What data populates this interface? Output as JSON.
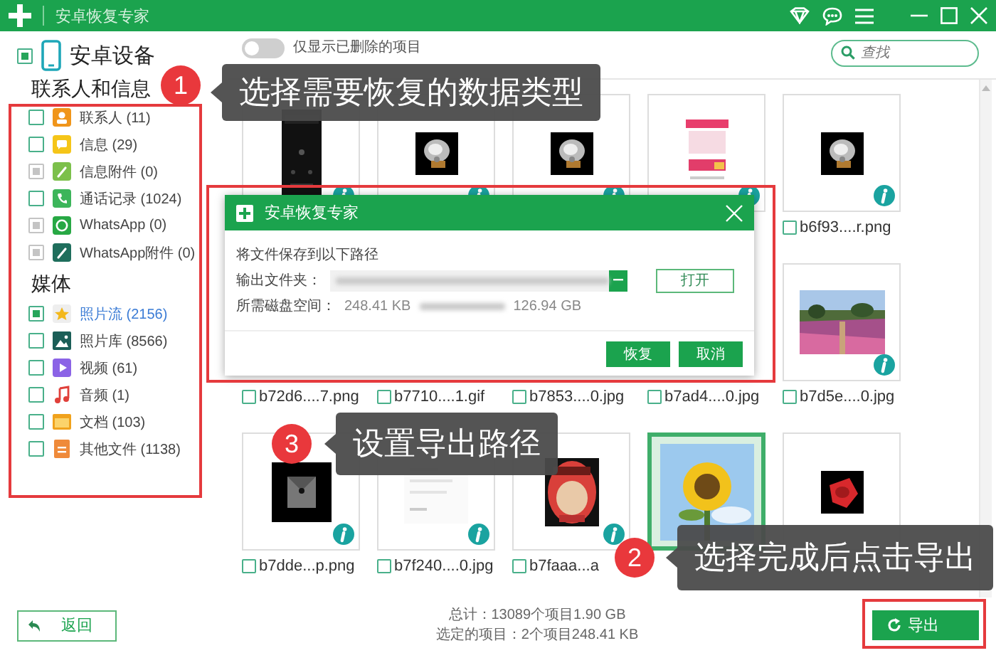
{
  "window": {
    "title": "安卓恢复专家"
  },
  "sidebar": {
    "device": {
      "label": "安卓设备",
      "checked": true
    },
    "groups": [
      {
        "heading": "联系人和信息",
        "items": [
          {
            "label": "联系人 (11)",
            "checked": false,
            "disabled": false,
            "selected": false
          },
          {
            "label": "信息 (29)",
            "checked": false,
            "disabled": false,
            "selected": false
          },
          {
            "label": "信息附件 (0)",
            "checked": false,
            "disabled": true,
            "selected": false
          },
          {
            "label": "通话记录 (1024)",
            "checked": false,
            "disabled": false,
            "selected": false
          },
          {
            "label": "WhatsApp (0)",
            "checked": false,
            "disabled": true,
            "selected": false
          },
          {
            "label": "WhatsApp附件 (0)",
            "checked": false,
            "disabled": true,
            "selected": false
          }
        ]
      },
      {
        "heading": "媒体",
        "items": [
          {
            "label": "照片流 (2156)",
            "checked": true,
            "disabled": false,
            "selected": true
          },
          {
            "label": "照片库 (8566)",
            "checked": false,
            "disabled": false,
            "selected": false
          },
          {
            "label": "视频 (61)",
            "checked": false,
            "disabled": false,
            "selected": false
          },
          {
            "label": "音频 (1)",
            "checked": false,
            "disabled": false,
            "selected": false
          },
          {
            "label": "文档 (103)",
            "checked": false,
            "disabled": false,
            "selected": false
          },
          {
            "label": "其他文件 (1138)",
            "checked": false,
            "disabled": false,
            "selected": false
          }
        ]
      }
    ]
  },
  "toolbar": {
    "toggle": {
      "label": "仅显示已删除的项目",
      "on": false
    },
    "search": {
      "placeholder": "查找"
    }
  },
  "cards": [
    {
      "selected": false
    },
    {
      "selected": false
    },
    {
      "selected": false
    },
    {
      "selected": false
    },
    {
      "name": "b6f93....r.png",
      "checked": false,
      "selected": false
    },
    {
      "name": "b72d6....7.png",
      "checked": false
    },
    {
      "name": "b7710....1.gif",
      "checked": false
    },
    {
      "name": "b7853....0.jpg",
      "checked": false
    },
    {
      "name": "b7ad4....0.jpg",
      "checked": false
    },
    {
      "name": "b7d5e....0.jpg",
      "checked": false,
      "selected": false
    },
    {
      "name": "b7dde...p.png",
      "checked": false,
      "selected": false
    },
    {
      "name": "b7f240....0.jpg",
      "checked": false,
      "selected": false
    },
    {
      "name": "b7faaa...a",
      "checked": false,
      "selected": false
    },
    {
      "selected": true
    },
    {
      "selected": false
    }
  ],
  "dialog": {
    "title": "安卓恢复专家",
    "prompt": "将文件保存到以下路径",
    "folder_label": "输出文件夹：",
    "open_button": "打开",
    "space_label": "所需磁盘空间：",
    "required_space": "248.41 KB",
    "free_space": "126.94 GB",
    "buttons": [
      "恢复",
      "取消"
    ]
  },
  "footer": {
    "back_button": "返回",
    "total": "总计：13089个项目1.90 GB",
    "selected_total": "选定的项目：2个项目248.41 KB",
    "export_button": "导出"
  },
  "callouts": [
    {
      "number": "1",
      "text": "选择需要恢复的数据类型"
    },
    {
      "number": "3",
      "text": "设置导出路径"
    },
    {
      "number": "2",
      "text": "选择完成后点击导出"
    }
  ]
}
